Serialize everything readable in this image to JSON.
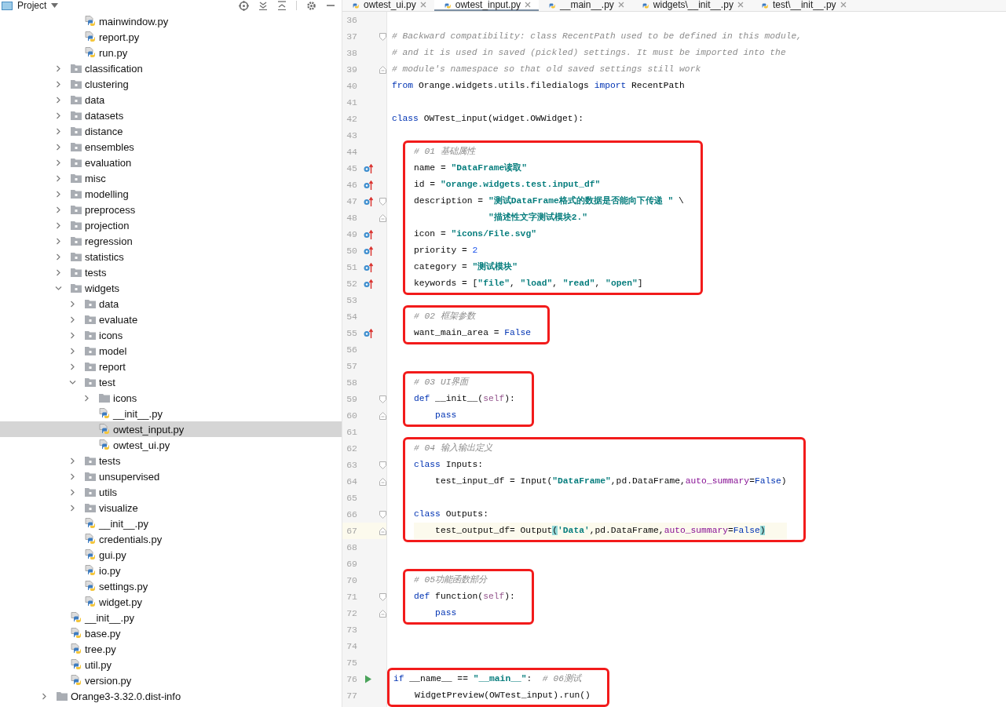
{
  "project_panel": {
    "title": "Project"
  },
  "tree": [
    {
      "children": [
        {
          "children": [
            {
              "label": "mainwindow.py",
              "kind": "file",
              "selected": false
            },
            {
              "label": "report.py",
              "kind": "file",
              "selected": false
            },
            {
              "label": "run.py",
              "kind": "file",
              "selected": false
            }
          ]
        },
        {
          "label": "classification",
          "kind": "package",
          "expanded": false,
          "selected": false
        },
        {
          "label": "clustering",
          "kind": "package",
          "expanded": false,
          "selected": false
        },
        {
          "label": "data",
          "kind": "package",
          "expanded": false,
          "selected": false
        },
        {
          "label": "datasets",
          "kind": "package",
          "expanded": false,
          "selected": false
        },
        {
          "label": "distance",
          "kind": "package",
          "expanded": false,
          "selected": false
        },
        {
          "label": "ensembles",
          "kind": "package",
          "expanded": false,
          "selected": false
        },
        {
          "label": "evaluation",
          "kind": "package",
          "expanded": false,
          "selected": false
        },
        {
          "label": "misc",
          "kind": "package",
          "expanded": false,
          "selected": false
        },
        {
          "label": "modelling",
          "kind": "package",
          "expanded": false,
          "selected": false
        },
        {
          "label": "preprocess",
          "kind": "package",
          "expanded": false,
          "selected": false
        },
        {
          "label": "projection",
          "kind": "package",
          "expanded": false,
          "selected": false
        },
        {
          "label": "regression",
          "kind": "package",
          "expanded": false,
          "selected": false
        },
        {
          "label": "statistics",
          "kind": "package",
          "expanded": false,
          "selected": false
        },
        {
          "label": "tests",
          "kind": "package",
          "expanded": false,
          "selected": false
        },
        {
          "label": "widgets",
          "kind": "package",
          "expanded": true,
          "selected": false,
          "children": [
            {
              "label": "data",
              "kind": "package",
              "expanded": false,
              "selected": false
            },
            {
              "label": "evaluate",
              "kind": "package",
              "expanded": false,
              "selected": false
            },
            {
              "label": "icons",
              "kind": "package",
              "expanded": false,
              "selected": false
            },
            {
              "label": "model",
              "kind": "package",
              "expanded": false,
              "selected": false
            },
            {
              "label": "report",
              "kind": "package",
              "expanded": false,
              "selected": false
            },
            {
              "label": "test",
              "kind": "package",
              "expanded": true,
              "selected": false,
              "children": [
                {
                  "label": "icons",
                  "kind": "folder",
                  "expanded": false,
                  "selected": false
                },
                {
                  "label": "__init__.py",
                  "kind": "file",
                  "selected": false
                },
                {
                  "label": "owtest_input.py",
                  "kind": "file",
                  "selected": true
                },
                {
                  "label": "owtest_ui.py",
                  "kind": "file",
                  "selected": false
                }
              ]
            },
            {
              "label": "tests",
              "kind": "package",
              "expanded": false,
              "selected": false
            },
            {
              "label": "unsupervised",
              "kind": "package",
              "expanded": false,
              "selected": false
            },
            {
              "label": "utils",
              "kind": "package",
              "expanded": false,
              "selected": false
            },
            {
              "label": "visualize",
              "kind": "package",
              "expanded": false,
              "selected": false
            },
            {
              "label": "__init__.py",
              "kind": "file",
              "selected": false
            },
            {
              "label": "credentials.py",
              "kind": "file",
              "selected": false
            },
            {
              "label": "gui.py",
              "kind": "file",
              "selected": false
            },
            {
              "label": "io.py",
              "kind": "file",
              "selected": false
            },
            {
              "label": "settings.py",
              "kind": "file",
              "selected": false
            },
            {
              "label": "widget.py",
              "kind": "file",
              "selected": false
            }
          ]
        },
        {
          "label": "__init__.py",
          "kind": "file",
          "selected": false
        },
        {
          "label": "base.py",
          "kind": "file",
          "selected": false
        },
        {
          "label": "tree.py",
          "kind": "file",
          "selected": false
        },
        {
          "label": "util.py",
          "kind": "file",
          "selected": false
        },
        {
          "label": "version.py",
          "kind": "file",
          "selected": false
        }
      ]
    },
    {
      "label": "Orange3-3.32.0.dist-info",
      "kind": "folder",
      "expanded": false,
      "selected": false
    }
  ],
  "tabs": [
    {
      "label": "owtest_ui.py",
      "selected": false
    },
    {
      "label": "owtest_input.py",
      "selected": true
    },
    {
      "label": "__main__.py",
      "selected": false
    },
    {
      "label": "widgets\\__init__.py",
      "selected": false
    },
    {
      "label": "test\\__init__.py",
      "selected": false
    }
  ],
  "code": {
    "blocks": [
      {
        "boxed": false,
        "indented": false,
        "lines": [
          {
            "number": "36",
            "current": false
          },
          {
            "number": "37",
            "current": false,
            "fold": {
              "kind": "start"
            },
            "tokens": [
              {
                "kind": "comment",
                "text": "# Backward compatibility: class RecentPath used to be defined in this module,"
              }
            ]
          },
          {
            "number": "38",
            "current": false,
            "tokens": [
              {
                "kind": "comment",
                "text": "# and it is used in saved (pickled) settings. It must be imported into the"
              }
            ]
          },
          {
            "number": "39",
            "current": false,
            "fold": {
              "kind": "end"
            },
            "tokens": [
              {
                "kind": "comment",
                "text": "# module's namespace so that old saved settings still work"
              }
            ]
          },
          {
            "number": "40",
            "current": false,
            "tokens": [
              {
                "kind": "keyword",
                "text": "from"
              },
              {
                "kind": "text",
                "text": " Orange.widgets.utils.filedialogs "
              },
              {
                "kind": "keyword",
                "text": "import"
              },
              {
                "kind": "text",
                "text": " RecentPath"
              }
            ]
          },
          {
            "number": "41",
            "current": false
          },
          {
            "number": "42",
            "current": false,
            "tokens": [
              {
                "kind": "keyword",
                "text": "class"
              },
              {
                "kind": "text",
                "text": " OWTest_input(widget.OWWidget):"
              }
            ]
          },
          {
            "number": "43",
            "current": false
          }
        ]
      },
      {
        "boxed": true,
        "indented": true,
        "lines": [
          {
            "number": "44",
            "current": false,
            "tokens": [
              {
                "kind": "comment",
                "text": "# 01 基础属性"
              }
            ]
          },
          {
            "number": "45",
            "current": false,
            "gutter_icon": {
              "kind": "override"
            },
            "tokens": [
              {
                "kind": "text",
                "text": "name = "
              },
              {
                "kind": "string",
                "text": "\"DataFrame读取\""
              }
            ]
          },
          {
            "number": "46",
            "current": false,
            "gutter_icon": {
              "kind": "override"
            },
            "tokens": [
              {
                "kind": "text",
                "text": "id = "
              },
              {
                "kind": "string",
                "text": "\"orange.widgets.test.input_df\""
              }
            ]
          },
          {
            "number": "47",
            "current": false,
            "gutter_icon": {
              "kind": "override"
            },
            "fold": {
              "kind": "start"
            },
            "tokens": [
              {
                "kind": "text",
                "text": "description = "
              },
              {
                "kind": "string",
                "text": "\"测试DataFrame格式的数据是否能向下传递 \""
              },
              {
                "kind": "text",
                "text": " \\"
              }
            ]
          },
          {
            "number": "48",
            "current": false,
            "fold": {
              "kind": "end"
            },
            "continuation": true,
            "tokens": [
              {
                "kind": "string",
                "text": "\"描述性文字测试模块2.\""
              }
            ]
          },
          {
            "number": "49",
            "current": false,
            "gutter_icon": {
              "kind": "override"
            },
            "tokens": [
              {
                "kind": "text",
                "text": "icon = "
              },
              {
                "kind": "string",
                "text": "\"icons/File.svg\""
              }
            ]
          },
          {
            "number": "50",
            "current": false,
            "gutter_icon": {
              "kind": "override"
            },
            "tokens": [
              {
                "kind": "text",
                "text": "priority = "
              },
              {
                "kind": "number",
                "text": "2"
              }
            ]
          },
          {
            "number": "51",
            "current": false,
            "gutter_icon": {
              "kind": "override"
            },
            "tokens": [
              {
                "kind": "text",
                "text": "category = "
              },
              {
                "kind": "string",
                "text": "\"测试模块\""
              }
            ]
          },
          {
            "number": "52",
            "current": false,
            "gutter_icon": {
              "kind": "override"
            },
            "tokens": [
              {
                "kind": "text",
                "text": "keywords = ["
              },
              {
                "kind": "string",
                "text": "\"file\""
              },
              {
                "kind": "text",
                "text": ", "
              },
              {
                "kind": "string",
                "text": "\"load\""
              },
              {
                "kind": "text",
                "text": ", "
              },
              {
                "kind": "string",
                "text": "\"read\""
              },
              {
                "kind": "text",
                "text": ", "
              },
              {
                "kind": "string",
                "text": "\"open\""
              },
              {
                "kind": "text",
                "text": "]"
              }
            ]
          }
        ]
      },
      {
        "boxed": false,
        "indented": false,
        "lines": [
          {
            "number": "53",
            "current": false
          }
        ]
      },
      {
        "boxed": true,
        "indented": true,
        "lines": [
          {
            "number": "54",
            "current": false,
            "tokens": [
              {
                "kind": "comment",
                "text": "# 02 框架参数"
              }
            ]
          },
          {
            "number": "55",
            "current": false,
            "gutter_icon": {
              "kind": "override"
            },
            "tokens": [
              {
                "kind": "text",
                "text": "want_main_area = "
              },
              {
                "kind": "keyword",
                "text": "False"
              }
            ]
          }
        ]
      },
      {
        "boxed": false,
        "indented": false,
        "lines": [
          {
            "number": "56",
            "current": false
          },
          {
            "number": "57",
            "current": false
          }
        ]
      },
      {
        "boxed": true,
        "indented": true,
        "lines": [
          {
            "number": "58",
            "current": false,
            "tokens": [
              {
                "kind": "comment",
                "text": "# 03 UI界面"
              }
            ]
          },
          {
            "number": "59",
            "current": false,
            "fold": {
              "kind": "start"
            },
            "tokens": [
              {
                "kind": "keyword",
                "text": "def"
              },
              {
                "kind": "text",
                "text": " __init__("
              },
              {
                "kind": "self",
                "text": "self"
              },
              {
                "kind": "text",
                "text": "):"
              }
            ]
          },
          {
            "number": "60",
            "current": false,
            "fold": {
              "kind": "end"
            },
            "nested": true,
            "tokens": [
              {
                "kind": "keyword",
                "text": "pass"
              }
            ]
          }
        ]
      },
      {
        "boxed": false,
        "indented": false,
        "lines": [
          {
            "number": "61",
            "current": false
          }
        ]
      },
      {
        "boxed": true,
        "indented": true,
        "lines": [
          {
            "number": "62",
            "current": false,
            "tokens": [
              {
                "kind": "comment",
                "text": "# 04 输入输出定义"
              }
            ]
          },
          {
            "number": "63",
            "current": false,
            "fold": {
              "kind": "start"
            },
            "tokens": [
              {
                "kind": "keyword",
                "text": "class"
              },
              {
                "kind": "text",
                "text": " Inputs:"
              }
            ]
          },
          {
            "number": "64",
            "current": false,
            "fold": {
              "kind": "end"
            },
            "nested": true,
            "tokens": [
              {
                "kind": "text",
                "text": "test_input_df = Input("
              },
              {
                "kind": "string",
                "text": "\"DataFrame\""
              },
              {
                "kind": "text",
                "text": ",pd.DataFrame,"
              },
              {
                "kind": "argument",
                "text": "auto_summary"
              },
              {
                "kind": "text",
                "text": "="
              },
              {
                "kind": "keyword",
                "text": "False"
              },
              {
                "kind": "text",
                "text": ")"
              }
            ]
          },
          {
            "number": "65",
            "current": false
          },
          {
            "number": "66",
            "current": false,
            "fold": {
              "kind": "start"
            },
            "tokens": [
              {
                "kind": "keyword",
                "text": "class"
              },
              {
                "kind": "text",
                "text": " Outputs:"
              }
            ]
          },
          {
            "number": "67",
            "current": true,
            "fold": {
              "kind": "end"
            },
            "nested": true,
            "tokens": [
              {
                "kind": "text",
                "text": "test_output_df= Output"
              },
              {
                "kind": "bracket",
                "text": "("
              },
              {
                "kind": "string",
                "text": "'Data'"
              },
              {
                "kind": "text",
                "text": ",pd.DataFrame,"
              },
              {
                "kind": "argument",
                "text": "auto_summary"
              },
              {
                "kind": "text",
                "text": "="
              },
              {
                "kind": "keyword",
                "text": "False"
              },
              {
                "kind": "bracket",
                "text": ")"
              }
            ]
          }
        ]
      },
      {
        "boxed": false,
        "indented": false,
        "lines": [
          {
            "number": "68",
            "current": false
          },
          {
            "number": "69",
            "current": false
          }
        ]
      },
      {
        "boxed": true,
        "indented": true,
        "lines": [
          {
            "number": "70",
            "current": false,
            "tokens": [
              {
                "kind": "comment",
                "text": "# 05功能函数部分"
              }
            ]
          },
          {
            "number": "71",
            "current": false,
            "fold": {
              "kind": "start"
            },
            "tokens": [
              {
                "kind": "keyword",
                "text": "def"
              },
              {
                "kind": "text",
                "text": " function("
              },
              {
                "kind": "self",
                "text": "self"
              },
              {
                "kind": "text",
                "text": "):"
              }
            ]
          },
          {
            "number": "72",
            "current": false,
            "fold": {
              "kind": "end"
            },
            "nested": true,
            "tokens": [
              {
                "kind": "keyword",
                "text": "pass"
              }
            ]
          }
        ]
      },
      {
        "boxed": false,
        "indented": false,
        "lines": [
          {
            "number": "73",
            "current": false
          },
          {
            "number": "74",
            "current": false
          },
          {
            "number": "75",
            "current": false
          }
        ]
      },
      {
        "boxed": true,
        "indented": false,
        "lines": [
          {
            "number": "76",
            "current": false,
            "gutter_icon": {
              "kind": "run"
            },
            "tokens": [
              {
                "kind": "keyword",
                "text": "if"
              },
              {
                "kind": "text",
                "text": " __name__ == "
              },
              {
                "kind": "string",
                "text": "\"__main__\""
              },
              {
                "kind": "text",
                "text": ":  "
              },
              {
                "kind": "comment",
                "text": "# 06测试"
              }
            ]
          },
          {
            "number": "77",
            "current": false,
            "nested": true,
            "tokens": [
              {
                "kind": "text",
                "text": "WidgetPreview(OWTest_input).run()"
              }
            ]
          }
        ]
      }
    ]
  }
}
